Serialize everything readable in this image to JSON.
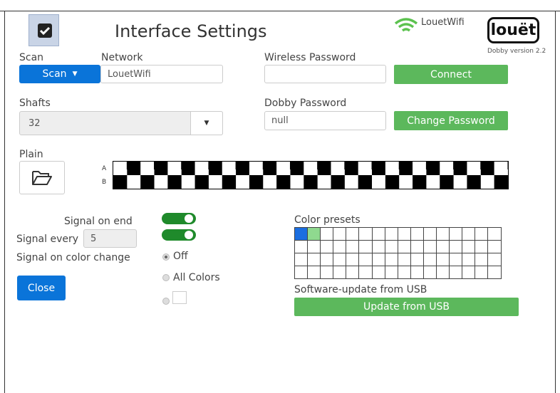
{
  "header": {
    "title": "Interface Settings",
    "wifi_name": "LouetWifi",
    "brand": "louët",
    "version": "Dobby version 2.2"
  },
  "scan": {
    "label": "Scan",
    "button_label": "Scan"
  },
  "network": {
    "label": "Network",
    "value": "LouetWifi"
  },
  "wireless": {
    "label": "Wireless Password",
    "value": "",
    "connect_label": "Connect"
  },
  "shafts": {
    "label": "Shafts",
    "value": "32"
  },
  "dobby": {
    "label": "Dobby Password",
    "value": "null",
    "change_label": "Change Password"
  },
  "plain": {
    "label": "Plain",
    "row_a": "A",
    "row_b": "B"
  },
  "signals": {
    "on_end_label": "Signal on end",
    "on_end_enabled": true,
    "every_label": "Signal every",
    "every_value": "5",
    "every_enabled": true,
    "color_change_label": "Signal on color change",
    "option_off": "Off",
    "option_all": "All Colors",
    "selected_option": "Off"
  },
  "close_label": "Close",
  "presets": {
    "label": "Color presets",
    "colors": [
      "#1b6ee0",
      "#8fd98f"
    ]
  },
  "update": {
    "label": "Software-update from USB",
    "button_label": "Update from USB"
  },
  "colors": {
    "green": "#5cb85c",
    "blue": "#0a74d9",
    "toggle": "#1f8a2b"
  }
}
